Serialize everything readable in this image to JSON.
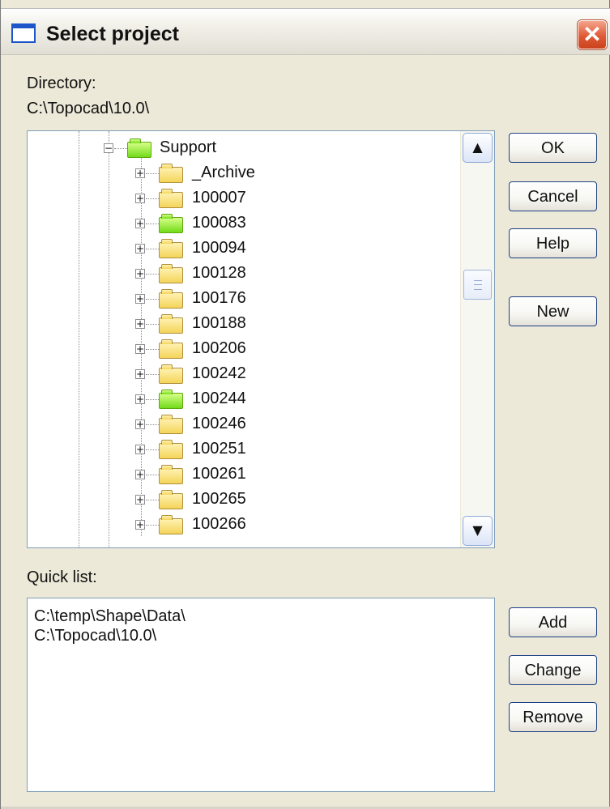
{
  "window": {
    "title": "Select project",
    "close_symbol": "✕"
  },
  "directory": {
    "label": "Directory:",
    "path": "C:\\Topocad\\10.0\\"
  },
  "tree": {
    "items": [
      {
        "label": "Support",
        "expander": "−",
        "folder_color": "green"
      },
      {
        "label": "_Archive",
        "expander": "+",
        "folder_color": "yellow"
      },
      {
        "label": "100007",
        "expander": "+",
        "folder_color": "yellow"
      },
      {
        "label": "100083",
        "expander": "+",
        "folder_color": "green"
      },
      {
        "label": "100094",
        "expander": "+",
        "folder_color": "yellow"
      },
      {
        "label": "100128",
        "expander": "+",
        "folder_color": "yellow"
      },
      {
        "label": "100176",
        "expander": "+",
        "folder_color": "yellow"
      },
      {
        "label": "100188",
        "expander": "+",
        "folder_color": "yellow"
      },
      {
        "label": "100206",
        "expander": "+",
        "folder_color": "yellow"
      },
      {
        "label": "100242",
        "expander": "+",
        "folder_color": "yellow"
      },
      {
        "label": "100244",
        "expander": "+",
        "folder_color": "green"
      },
      {
        "label": "100246",
        "expander": "+",
        "folder_color": "yellow"
      },
      {
        "label": "100251",
        "expander": "+",
        "folder_color": "yellow"
      },
      {
        "label": "100261",
        "expander": "+",
        "folder_color": "yellow"
      },
      {
        "label": "100265",
        "expander": "+",
        "folder_color": "yellow"
      },
      {
        "label": "100266",
        "expander": "+",
        "folder_color": "yellow"
      }
    ],
    "scroll_up_symbol": "▲",
    "scroll_down_symbol": "▼"
  },
  "buttons": {
    "ok": "OK",
    "cancel": "Cancel",
    "help": "Help",
    "new": "New",
    "add": "Add",
    "change": "Change",
    "remove": "Remove"
  },
  "quick_list": {
    "label": "Quick list:",
    "items": [
      "C:\\temp\\Shape\\Data\\",
      "C:\\Topocad\\10.0\\"
    ]
  },
  "colors": {
    "dialog_background": "#ece9d8",
    "close_button": "#df5a36",
    "folder_yellow": "#f4d45a",
    "folder_green": "#72db19"
  },
  "icons": {
    "window": "window-icon",
    "close": "close-icon",
    "collapse": "minus-box-icon",
    "expand": "plus-box-icon",
    "folder": "folder-icon",
    "scroll_up": "chevron-up-icon",
    "scroll_down": "chevron-down-icon"
  }
}
